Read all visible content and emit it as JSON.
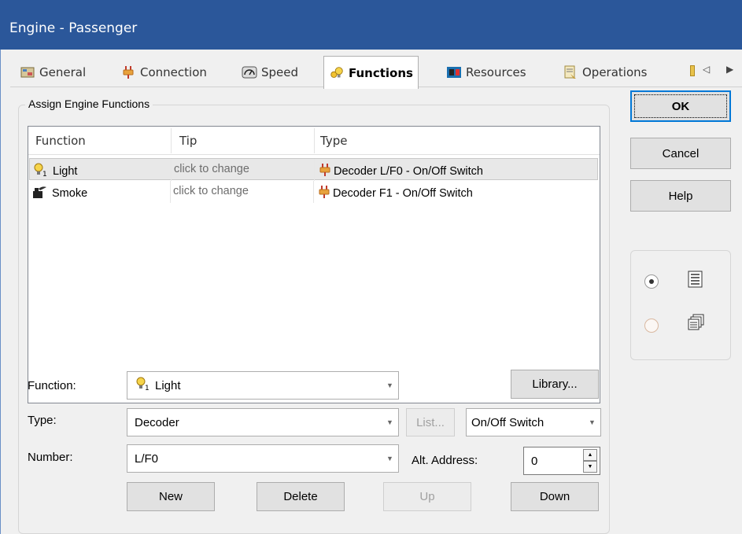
{
  "window": {
    "title": "Engine - Passenger"
  },
  "tabs": [
    {
      "label": "General",
      "icon": "general-icon"
    },
    {
      "label": "Connection",
      "icon": "plug-icon"
    },
    {
      "label": "Speed",
      "icon": "speedometer-icon"
    },
    {
      "label": "Functions",
      "icon": "lightbulb-icon",
      "active": true
    },
    {
      "label": "Resources",
      "icon": "resources-icon"
    },
    {
      "label": "Operations",
      "icon": "operations-icon"
    }
  ],
  "group": {
    "legend": "Assign Engine Functions"
  },
  "list": {
    "columns": [
      "Function",
      "Tip",
      "Type"
    ],
    "rows": [
      {
        "function": "Light",
        "tip": "click to change",
        "type": "Decoder L/F0 - On/Off Switch",
        "icon": "light-bulb-icon",
        "selected": true
      },
      {
        "function": "Smoke",
        "tip": "click to change",
        "type": "Decoder F1 - On/Off Switch",
        "icon": "smokestack-icon",
        "selected": false
      }
    ]
  },
  "form": {
    "function_label": "Function:",
    "function_value": "Light",
    "type_label": "Type:",
    "type_value": "Decoder",
    "number_label": "Number:",
    "number_value": "L/F0",
    "list_button": "List...",
    "switch_value": "On/Off Switch",
    "alt_address_label": "Alt. Address:",
    "alt_address_value": "0",
    "library_button": "Library..."
  },
  "actions": {
    "new": "New",
    "delete": "Delete",
    "up": "Up",
    "down": "Down"
  },
  "dialog_buttons": {
    "ok": "OK",
    "cancel": "Cancel",
    "help": "Help"
  },
  "colors": {
    "titlebar": "#2b579a",
    "accent": "#0078d7"
  }
}
